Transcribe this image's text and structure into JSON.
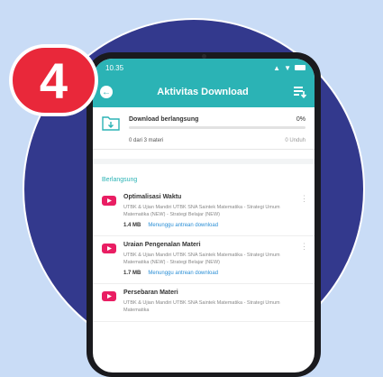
{
  "step": {
    "number": "4"
  },
  "colors": {
    "circle": "#33398d",
    "badge": "#e9283a",
    "appbar": "#2bb3b5",
    "link": "#2b8fd6",
    "background": "#c9dcf6"
  },
  "status_bar": {
    "time": "10.35"
  },
  "header": {
    "title": "Aktivitas Download",
    "back_icon": "arrow-left-icon",
    "action_icon": "download-list-icon"
  },
  "progress_card": {
    "title": "Download berlangsung",
    "percent": "0%",
    "count": "0 dari 3 materi",
    "right_label": "0 Unduh"
  },
  "section": {
    "title": "Berlangsung"
  },
  "downloads": [
    {
      "title": "Optimalisasi Waktu",
      "description": "UTBK & Ujian Mandiri UTBK SNA Saintek Matematika - Strategi Umum Matematika (NEW) - Strategi Belajar (NEW)",
      "size": "1.4 MB",
      "status": "Menunggu antrean download"
    },
    {
      "title": "Uraian Pengenalan Materi",
      "description": "UTBK & Ujian Mandiri UTBK SNA Saintek Matematika - Strategi Umum Matematika (NEW) - Strategi Belajar (NEW)",
      "size": "1.7 MB",
      "status": "Menunggu antrean download"
    },
    {
      "title": "Persebaran Materi",
      "description": "UTBK & Ujian Mandiri UTBK SNA Saintek Matematika - Strategi Umum Matematika",
      "size": "",
      "status": ""
    }
  ]
}
